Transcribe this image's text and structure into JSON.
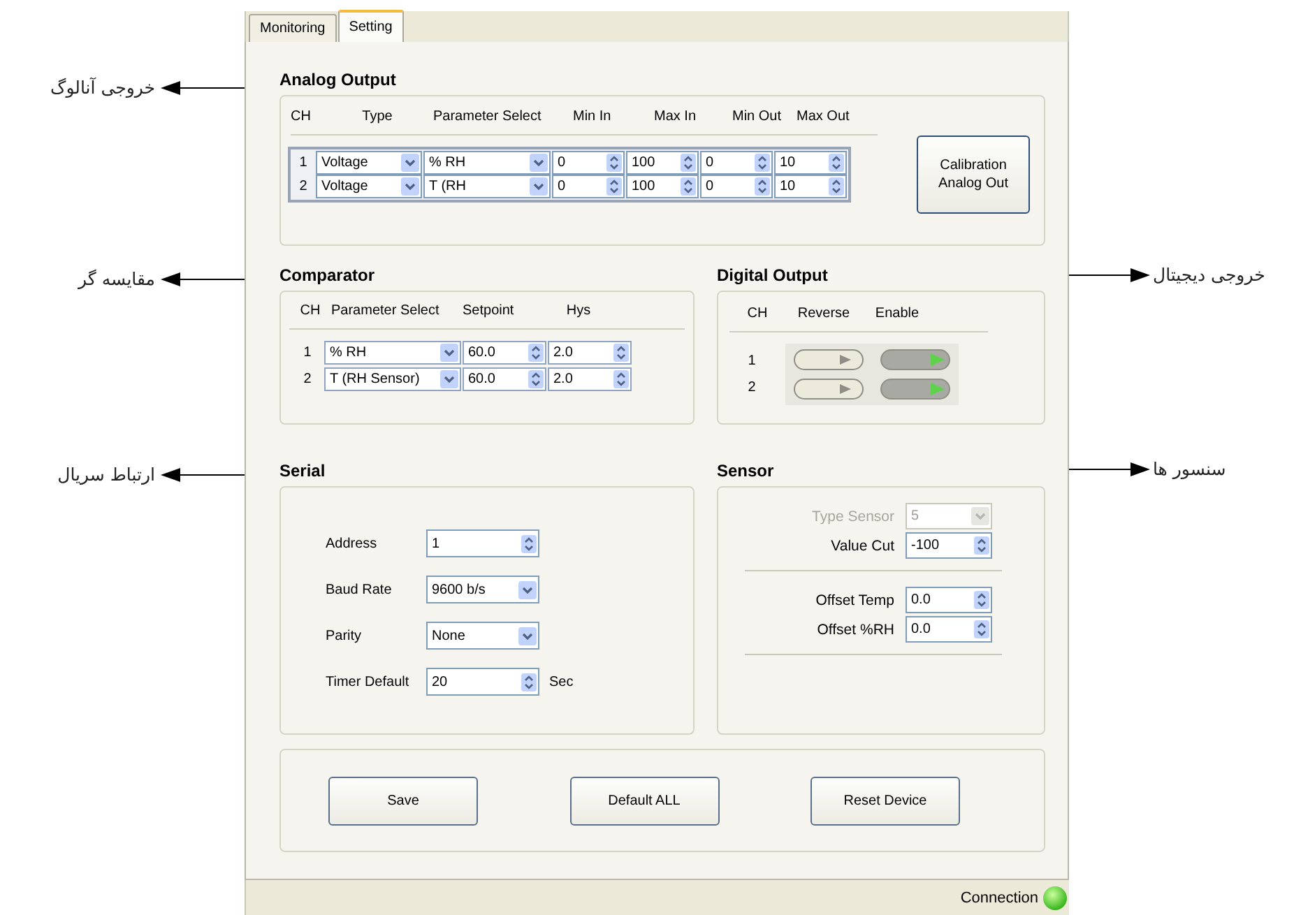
{
  "tabs": [
    {
      "label": "Monitoring",
      "selected": false
    },
    {
      "label": "Setting",
      "selected": true
    }
  ],
  "analog_output": {
    "title": "Analog Output",
    "annotation": "خروجی آنالوگ",
    "columns": [
      "CH",
      "Type",
      "Parameter Select",
      "Min In",
      "Max In",
      "Min Out",
      "Max Out"
    ],
    "rows": [
      {
        "ch": "1",
        "type": "Voltage",
        "parameter": "% RH",
        "min_in": "0",
        "max_in": "100",
        "min_out": "0",
        "max_out": "10"
      },
      {
        "ch": "2",
        "type": "Voltage",
        "parameter": "T (RH",
        "min_in": "0",
        "max_in": "100",
        "min_out": "0",
        "max_out": "10"
      }
    ],
    "calibration_button": "Calibration Analog Out"
  },
  "comparator": {
    "title": "Comparator",
    "annotation": "مقایسه گر",
    "columns": [
      "CH",
      "Parameter Select",
      "Setpoint",
      "Hys"
    ],
    "rows": [
      {
        "ch": "1",
        "parameter": "% RH",
        "setpoint": "60.0",
        "hys": "2.0"
      },
      {
        "ch": "2",
        "parameter": "T (RH Sensor)",
        "setpoint": "60.0",
        "hys": "2.0"
      }
    ]
  },
  "digital_output": {
    "title": "Digital Output",
    "annotation": "خروجی دیجیتال",
    "columns": [
      "CH",
      "Reverse",
      "Enable"
    ],
    "rows": [
      {
        "ch": "1",
        "reverse": false,
        "enable": true
      },
      {
        "ch": "2",
        "reverse": false,
        "enable": true
      }
    ]
  },
  "serial": {
    "title": "Serial",
    "annotation": "ارتباط سریال",
    "fields": [
      {
        "kind": "spin",
        "label": "Address",
        "value": "1"
      },
      {
        "kind": "select",
        "label": "Baud Rate",
        "value": "9600 b/s"
      },
      {
        "kind": "select",
        "label": "Parity",
        "value": "None"
      },
      {
        "kind": "spin",
        "label": "Timer Default",
        "value": "20",
        "unit": "Sec"
      }
    ]
  },
  "sensor": {
    "title": "Sensor",
    "annotation": "سنسور ها",
    "fields": [
      {
        "kind": "select",
        "label": "Type Sensor",
        "value": "5",
        "disabled": true
      },
      {
        "kind": "spin",
        "label": "Value Cut",
        "value": "-100",
        "disabled": false
      }
    ],
    "offsets": [
      {
        "label": "Offset Temp",
        "value": "0.0"
      },
      {
        "label": "Offset %RH",
        "value": "0.0"
      }
    ]
  },
  "buttons": [
    "Save",
    "Default ALL",
    "Reset Device"
  ],
  "status_bar": {
    "label": "Connection",
    "connected": true
  }
}
